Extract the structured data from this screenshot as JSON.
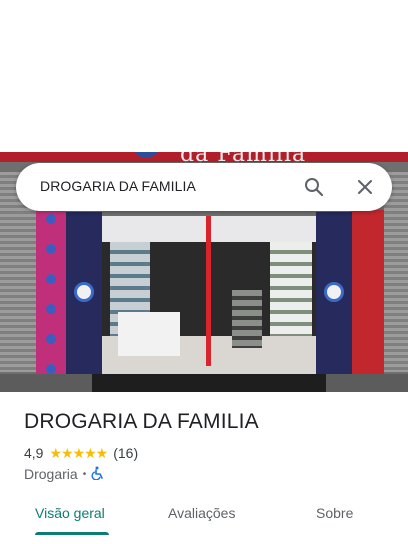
{
  "search": {
    "query": "DROGARIA DA FAMILIA",
    "search_icon": "search-icon",
    "close_icon": "close-icon"
  },
  "photo": {
    "sign_text": "da Família"
  },
  "place": {
    "name": "DROGARIA DA FAMILIA",
    "rating": "4,9",
    "stars": "★★★★★",
    "star_rating": 4.9,
    "review_count": "(16)",
    "category": "Drogaria",
    "separator": "•",
    "accessibility_icon": "wheelchair-icon"
  },
  "tabs": [
    {
      "label": "Visão geral",
      "active": true
    },
    {
      "label": "Avaliações",
      "active": false
    },
    {
      "label": "Sobre",
      "active": false
    }
  ],
  "colors": {
    "accent": "#0d7d73",
    "star": "#fbbc04",
    "accessibility": "#1a73e8"
  }
}
